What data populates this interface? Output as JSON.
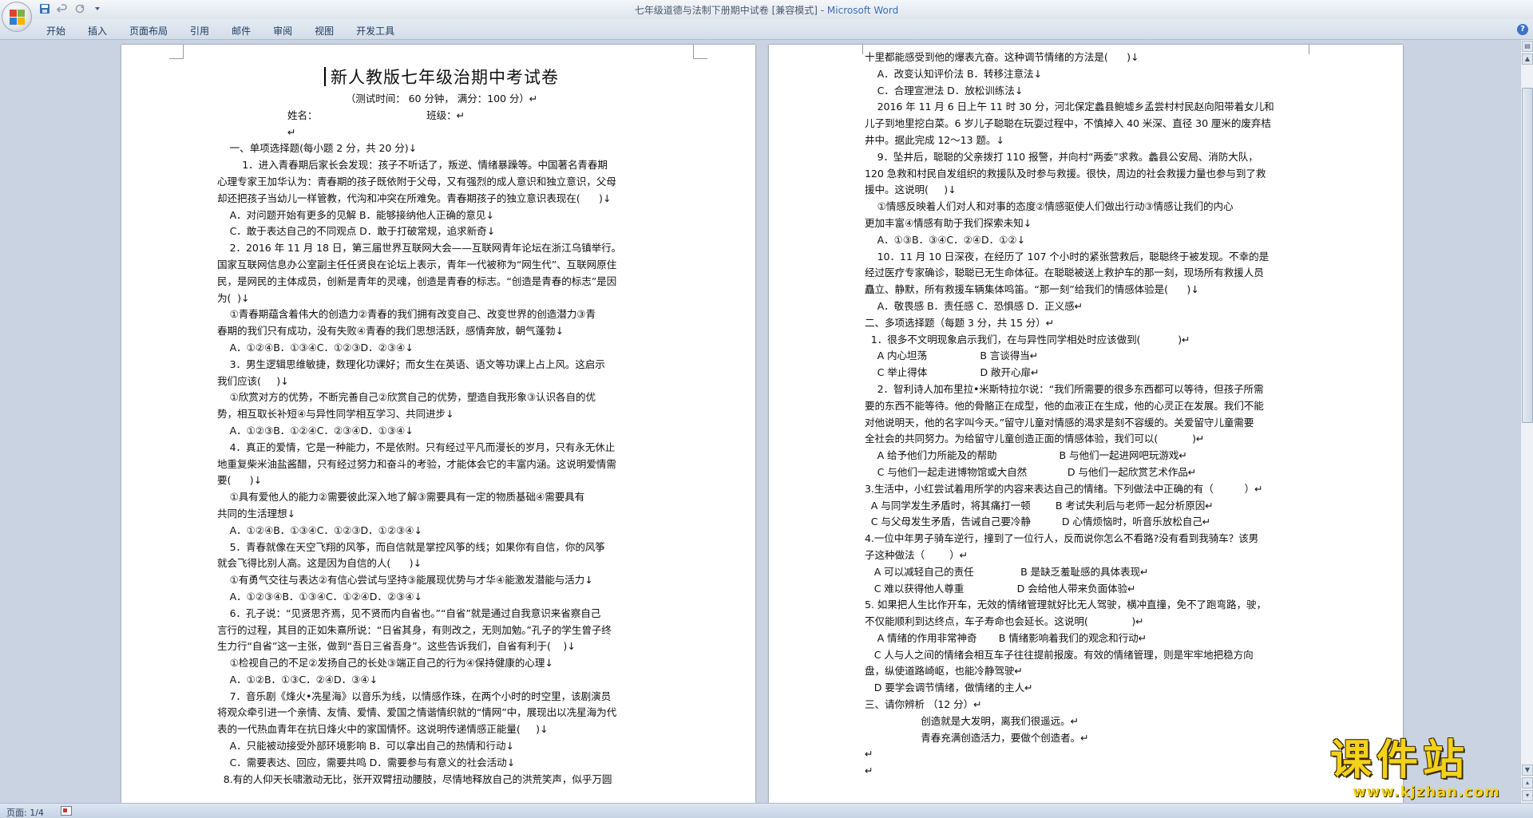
{
  "window": {
    "title": "七年级道德与法制下册期中试卷 [兼容模式] - ",
    "app_name": "Microsoft Word"
  },
  "quick_access": {
    "icons": [
      "save-icon",
      "undo-icon",
      "redo-icon",
      "customize-icon"
    ]
  },
  "ribbon": {
    "tabs": [
      "开始",
      "插入",
      "页面布局",
      "引用",
      "邮件",
      "审阅",
      "视图",
      "开发工具"
    ],
    "help": "?"
  },
  "document": {
    "left_page": [
      "新人教版七年级治期中考试卷",
      "（测试时间： 60 分钟， 满分：100 分）↵",
      "姓名：                                   班级：↵",
      "↵",
      "    一、单项选择题(每小题 2 分，共 20 分)↓",
      "        1．进入青春期后家长会发现：孩子不听话了，叛逆、情绪暴躁等。中国著名青春期",
      "心理专家王加华认为：青春期的孩子既依附于父母，又有强烈的成人意识和独立意识，父母",
      "却还把孩子当幼儿一样管教，代沟和冲突在所难免。青春期孩子的独立意识表现在(      )↓",
      "    A．对问题开始有更多的见解 B．能够接纳他人正确的意见↓",
      "    C．敢于表达自己的不同观点 D．敢于打破常规，追求新奇↓",
      "    2．2016 年 11 月 18 日，第三届世界互联网大会——互联网青年论坛在浙江乌镇举行。",
      "国家互联网信息办公室副主任任贤良在论坛上表示，青年一代被称为“网生代”、互联网原住",
      "民，是网民的主体成员，创新是青年的灵魂，创造是青春的标志。“创造是青春的标志”是因",
      "为(  )↓",
      "    ①青春期蕴含着伟大的创造力②青春的我们拥有改变自己、改变世界的创造潜力③青",
      "春期的我们只有成功，没有失败④青春的我们思想活跃，感情奔放，朝气蓬勃↓",
      "    A．①②④B．①③④C．①②③D．②③④↓",
      "    3．男生逻辑思维敏捷，数理化功课好；而女生在英语、语文等功课上占上风。这启示",
      "我们应该(     )↓",
      "    ①欣赏对方的优势，不断完善自己②欣赏自己的优势，塑造自我形象③认识各自的优",
      "势，相互取长补短④与异性同学相互学习、共同进步↓",
      "    A．①②③B．①②④C．②③④D．①③④↓",
      "    4．真正的爱情，它是一种能力，不是依附。只有经过平凡而漫长的岁月，只有永无休止",
      "地重复柴米油盐酱醋，只有经过努力和奋斗的考验，才能体会它的丰富内涵。这说明爱情需",
      "要(      )↓",
      "    ①具有爱他人的能力②需要彼此深入地了解③需要具有一定的物质基础④需要具有",
      "共同的生活理想↓",
      "    A．①②④B．①③④C．①②③D．①②③④↓",
      "    5．青春就像在天空飞翔的风筝，而自信就是掌控风筝的线；如果你有自信，你的风筝",
      "就会飞得比别人高。这是因为自信的人(      )↓",
      "    ①有勇气交往与表达②有信心尝试与坚持③能展现优势与才华④能激发潜能与活力↓",
      "    A．①②③④B．①③④C．①②④D．②③④↓",
      "    6．孔子说：“见贤思齐焉，见不贤而内自省也。”“自省”就是通过自我意识来省察自己",
      "言行的过程，其目的正如朱熹所说：“日省其身，有则改之，无则加勉。”孔子的学生曾子终",
      "生力行“自省”这一主张，做到“吾日三省吾身”。这些告诉我们，自省有利于(    )↓",
      "    ①检视自己的不足②发扬自己的长处③端正自己的行为④保持健康的心理↓",
      "    A．①②B．①③C．②④D．③④↓",
      "    7．音乐剧《烽火•冼星海》以音乐为线，以情感作珠，在两个小时的时空里，该剧演员",
      "将观众牵引进一个亲情、友情、爱情、爱国之情谐情织就的“情网”中，展现出以冼星海为代",
      "表的一代热血青年在抗日烽火中的家国情怀。这说明传递情感正能量(     )↓",
      "    A．只能被动接受外部环境影响 B．可以拿出自己的热情和行动↓",
      "    C．需要表达、回应，需要共鸣 D．需要参与有意义的社会活动↓",
      "  8.有的人仰天长啸激动无比，张开双臂扭动腰肢，尽情地释放自己的洪荒笑声，似乎万圆"
    ],
    "right_page": [
      "十里都能感受到他的爆表亢奋。这种调节情绪的方法是(      )↓",
      "    A．改变认知评价法 B．转移注意法↓",
      "    C．合理宣泄法 D．放松训练法↓",
      "    2016 年 11 月 6 日上午 11 时 30 分，河北保定蠡县鲍墟乡孟尝村村民赵向阳带着女儿和",
      "儿子到地里挖白菜。6 岁儿子聪聪在玩耍过程中，不慎掉入 40 米深、直径 30 厘米的废弃桔",
      "井中。据此完成 12～13 题。↓",
      "    9．坠井后，聪聪的父亲拨打 110 报警，并向村“两委”求救。蠡县公安局、消防大队，",
      "120 急救和村民自发组织的救援队及时参与救援。很快，周边的社会救援力量也参与到了救",
      "援中。这说明(     )↓",
      "    ①情感反映着人们对人和对事的态度②情感驱使人们做出行动③情感让我们的内心",
      "更加丰富④情感有助于我们探索未知↓",
      "    A．①③B．③④C．②④D．①②↓",
      "    10．11 月 10 日深夜，在经历了 107 个小时的紧张营救后，聪聪终于被发现。不幸的是",
      "经过医疗专家确诊，聪聪已无生命体征。在聪聪被送上救护车的那一刻，现场所有救援人员",
      "矗立、静默，所有救援车辆集体鸣笛。“那一刻”给我们的情感体验是(      )↓",
      "    A．敬畏感 B．责任感 C．恐惧感 D．正义感↵",
      "二、多项选择题（每题 3 分，共 15 分）↵",
      "  1．很多不文明现象启示我们，在与异性同学相处时应该做到(            )↵",
      "    A 内心坦荡                 B 言谈得当↵",
      "    C 举止得体                 D 敞开心扉↵",
      "    2．智利诗人加布里拉•米斯特拉尔说：“我们所需要的很多东西都可以等待，但孩子所需",
      "要的东西不能等待。他的骨骼正在成型，他的血液正在生成，他的心灵正在发展。我们不能",
      "对他说明天，他的名字叫今天。”留守儿童对情感的渴求是刻不容缓的。关爱留守儿童需要",
      "全社会的共同努力。为给留守儿童创造正面的情感体验，我们可以(           )↵",
      "    A 给予他们力所能及的帮助                    B 与他们一起进网吧玩游戏↵",
      "    C 与他们一起走进博物馆或大自然             D 与他们一起欣赏艺术作品↵",
      "3.生活中，小红尝试着用所学的内容来表达自己的情绪。下列做法中正确的有（          ）↵",
      "  A 与同学发生矛盾时，将其痛打一顿        B 考试失利后与老师一起分析原因↵",
      "  C 与父母发生矛盾，告诫自己要冷静          D 心情烦恼时，听音乐放松自己↵",
      "4.一位中年男子骑车逆行，撞到了一位行人，反而说你怎么不看路?没有看到我骑车？该男",
      "子这种做法（        ）↵",
      "   A 可以减轻自己的责任               B 是缺乏羞耻感的具体表现↵",
      "   C 难以获得他人尊重                 D 会给他人带来负面体验↵",
      "5. 如果把人生比作开车，无效的情绪管理就好比无人驾驶，横冲直撞，免不了跑弯路，驶，",
      "不仅能顺利到达终点，车子寿命也会延长。这说明(              )↵",
      "    A 情绪的作用非常神奇       B 情绪影响着我们的观念和行动↵",
      "   C 人与人之间的情绪会相互车子往往提前报废。有效的情绪管理，则是牢牢地把稳方向",
      "盘，纵使道路崎岖，也能冷静驾驶↵",
      "   D 要学会调节情绪，做情绪的主人↵",
      "三、请你辨析 （12 分）↵",
      "                  创造就是大发明，离我们很遥远。↵",
      "                  青春充满创造活力，要做个创造者。↵",
      "↵",
      "↵"
    ]
  },
  "status_bar": {
    "page_info": "页面: 1/4"
  },
  "watermark": {
    "main": "课件站",
    "url": "www.kjzhan.com"
  }
}
